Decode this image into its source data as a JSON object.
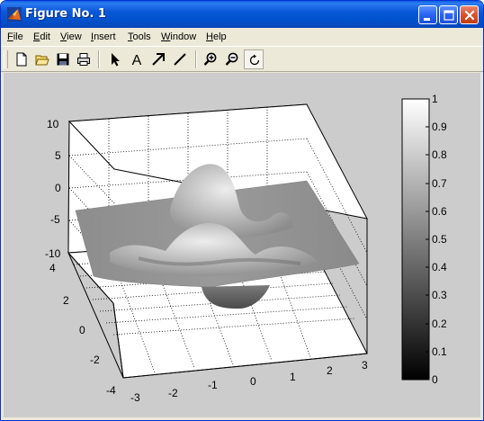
{
  "window": {
    "title": "Figure No. 1",
    "icon": "matlab-logo-icon"
  },
  "title_buttons": [
    "minimize-icon",
    "maximize-icon",
    "close-icon"
  ],
  "menu": [
    {
      "label": "File",
      "mnemonic": "F",
      "rest": "ile"
    },
    {
      "label": "Edit",
      "mnemonic": "E",
      "rest": "dit"
    },
    {
      "label": "View",
      "mnemonic": "V",
      "rest": "iew"
    },
    {
      "label": "Insert",
      "mnemonic": "I",
      "rest": "nsert"
    },
    {
      "label": "Tools",
      "mnemonic": "T",
      "rest": "ools"
    },
    {
      "label": "Window",
      "mnemonic": "W",
      "rest": "indow"
    },
    {
      "label": "Help",
      "mnemonic": "H",
      "rest": "elp"
    }
  ],
  "toolbar": {
    "tools": [
      {
        "name": "new-figure",
        "icon": "new-file-icon"
      },
      {
        "name": "open-file",
        "icon": "open-folder-icon"
      },
      {
        "name": "save",
        "icon": "save-disk-icon"
      },
      {
        "name": "print",
        "icon": "printer-icon"
      },
      {
        "name": "edit-plot",
        "icon": "arrow-pointer-icon"
      },
      {
        "name": "insert-text",
        "icon": "text-a-icon",
        "glyph": "A"
      },
      {
        "name": "insert-arrow",
        "icon": "arrow-icon"
      },
      {
        "name": "insert-line",
        "icon": "line-icon"
      },
      {
        "name": "zoom-in",
        "icon": "zoom-in-icon"
      },
      {
        "name": "zoom-out",
        "icon": "zoom-out-icon"
      },
      {
        "name": "rotate-3d",
        "icon": "rotate-icon",
        "pressed": true
      }
    ]
  },
  "plot": {
    "z_ticks": [
      "10",
      "5",
      "0",
      "-5",
      "-10"
    ],
    "y_ticks": [
      "4",
      "2",
      "0",
      "-2",
      "-4"
    ],
    "x_ticks": [
      "-3",
      "-2",
      "-1",
      "0",
      "1",
      "2",
      "3"
    ],
    "colorbar_ticks": [
      "1",
      "0.9",
      "0.8",
      "0.7",
      "0.6",
      "0.5",
      "0.4",
      "0.3",
      "0.2",
      "0.1",
      "0"
    ],
    "colormap": "gray",
    "grid": true
  },
  "colors": {
    "titlebar": "#0a58d8",
    "figure_bg": "#cccccc",
    "axes_bg": "#ffffff",
    "chrome": "#ece9d8"
  }
}
